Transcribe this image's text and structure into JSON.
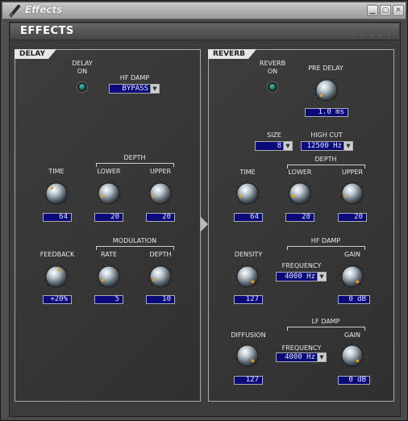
{
  "window": {
    "title": "Effects",
    "controls": [
      "minimize",
      "maximize",
      "close"
    ]
  },
  "header": {
    "title": "EFFECTS",
    "dots": ". . . . ."
  },
  "delay": {
    "tab": "DELAY",
    "on_label": "DELAY\nON",
    "on_l1": "DELAY",
    "on_l2": "ON",
    "hf_damp": {
      "label": "HF DAMP",
      "value": "BYPASS"
    },
    "depth_group": "DEPTH",
    "time": {
      "label": "TIME",
      "value": "64"
    },
    "lower": {
      "label": "LOWER",
      "value": "20"
    },
    "upper": {
      "label": "UPPER",
      "value": "20"
    },
    "modulation_group": "MODULATION",
    "feedback": {
      "label": "FEEDBACK",
      "value": "+20%"
    },
    "rate": {
      "label": "RATE",
      "value": "5"
    },
    "depth": {
      "label": "DEPTH",
      "value": "10"
    }
  },
  "reverb": {
    "tab": "REVERB",
    "on_l1": "REVERB",
    "on_l2": "ON",
    "pre_delay": {
      "label": "PRE DELAY",
      "value": "1.0 ms"
    },
    "size": {
      "label": "SIZE",
      "value": "8"
    },
    "high_cut": {
      "label": "HIGH CUT",
      "value": "12500 Hz"
    },
    "depth_group": "DEPTH",
    "time": {
      "label": "TIME",
      "value": "64"
    },
    "lower": {
      "label": "LOWER",
      "value": "20"
    },
    "upper": {
      "label": "UPPER",
      "value": "20"
    },
    "hf_damp_group": "HF DAMP",
    "density": {
      "label": "DENSITY",
      "value": "127"
    },
    "hf_frequency": {
      "label": "FREQUENCY",
      "value": "4000 Hz"
    },
    "hf_gain": {
      "label": "GAIN",
      "value": "0 dB"
    },
    "lf_damp_group": "LF DAMP",
    "diffusion": {
      "label": "DIFFUSION",
      "value": "127"
    },
    "lf_frequency": {
      "label": "FREQUENCY",
      "value": "4000 Hz"
    },
    "lf_gain": {
      "label": "GAIN",
      "value": "0 dB"
    }
  },
  "colors": {
    "display_bg": "#0b0a7a",
    "led": "#1aa090",
    "accent_dot": "#e8a020"
  }
}
